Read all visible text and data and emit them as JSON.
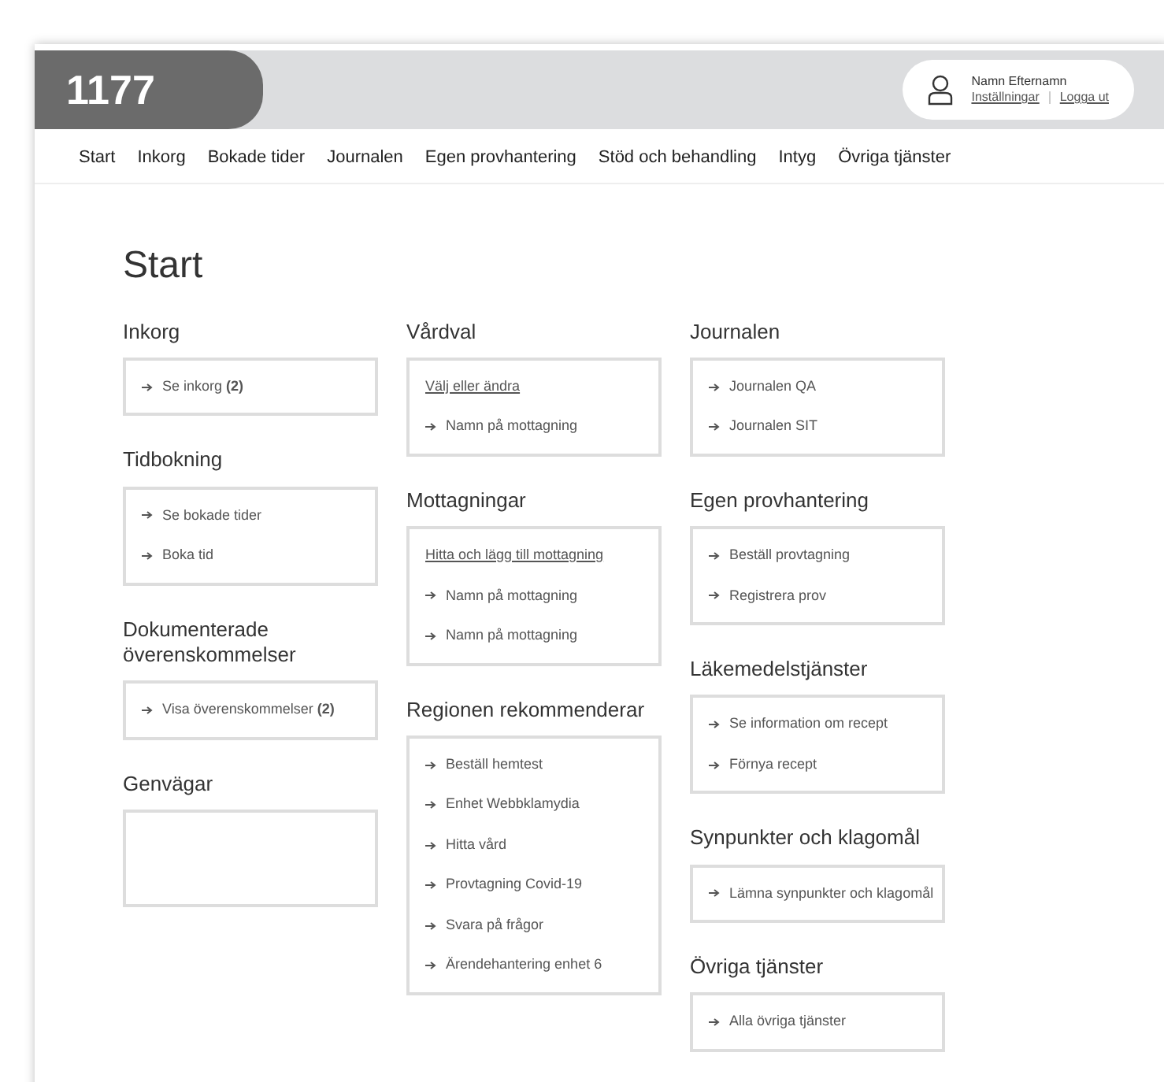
{
  "header": {
    "logo": "1177",
    "user": {
      "name": "Namn Efternamn",
      "links": [
        "Inställningar",
        "Logga ut"
      ]
    }
  },
  "nav": [
    "Start",
    "Inkorg",
    "Bokade tider",
    "Journalen",
    "Egen provhantering",
    "Stöd och behandling",
    "Intyg",
    "Övriga tjänster"
  ],
  "page_title": "Start",
  "columns": [
    [
      {
        "title": "Inkorg",
        "items": [
          {
            "kind": "arrow",
            "text": "Se inkorg **(2)**"
          }
        ]
      },
      {
        "title": "Tidbokning",
        "items": [
          {
            "kind": "arrow",
            "text": "Se bokade tider"
          },
          {
            "kind": "arrow",
            "text": "Boka tid"
          }
        ]
      },
      {
        "title": "Dokumenterade överenskommelser",
        "items": [
          {
            "kind": "arrow",
            "text": "Visa överenskommelser **(2)**"
          }
        ]
      },
      {
        "title": "Genvägar"
      }
    ],
    [
      {
        "title": "Vårdval",
        "items": [
          {
            "kind": "link",
            "text": "Välj eller ändra"
          },
          {
            "kind": "arrow",
            "text": "Namn på mottagning"
          }
        ]
      },
      {
        "title": "Mottagningar",
        "items": [
          {
            "kind": "link",
            "text": "Hitta och lägg till mottagning"
          },
          {
            "kind": "arrow",
            "text": "Namn på mottagning"
          },
          {
            "kind": "arrow",
            "text": "Namn på mottagning"
          }
        ]
      },
      {
        "title": "Regionen rekommenderar",
        "items": [
          {
            "kind": "arrow",
            "text": "Beställ hemtest"
          },
          {
            "kind": "arrow",
            "text": "Enhet Webbklamydia"
          },
          {
            "kind": "arrow",
            "text": "Hitta vård"
          },
          {
            "kind": "arrow",
            "text": "Provtagning Covid-19"
          },
          {
            "kind": "arrow",
            "text": "Svara på frågor"
          },
          {
            "kind": "arrow",
            "text": "Ärendehantering enhet 6"
          }
        ]
      }
    ],
    [
      {
        "title": "Journalen",
        "items": [
          {
            "kind": "arrow",
            "text": "Journalen QA"
          },
          {
            "kind": "arrow",
            "text": "Journalen SIT"
          }
        ]
      },
      {
        "title": "Egen provhantering",
        "items": [
          {
            "kind": "arrow",
            "text": "Beställ provtagning"
          },
          {
            "kind": "arrow",
            "text": "Registrera prov"
          }
        ]
      },
      {
        "title": "Läkemedelstjänster",
        "items": [
          {
            "kind": "arrow",
            "text": "Se information om recept"
          },
          {
            "kind": "arrow",
            "text": "Förnya recept"
          }
        ]
      },
      {
        "title": "Synpunkter och klagomål",
        "items": [
          {
            "kind": "arrow",
            "text": "Lämna synpunkter och klagomål"
          }
        ]
      },
      {
        "title": "Övriga tjänster",
        "items": [
          {
            "kind": "arrow",
            "text": "Alla övriga tjänster"
          }
        ]
      }
    ]
  ]
}
